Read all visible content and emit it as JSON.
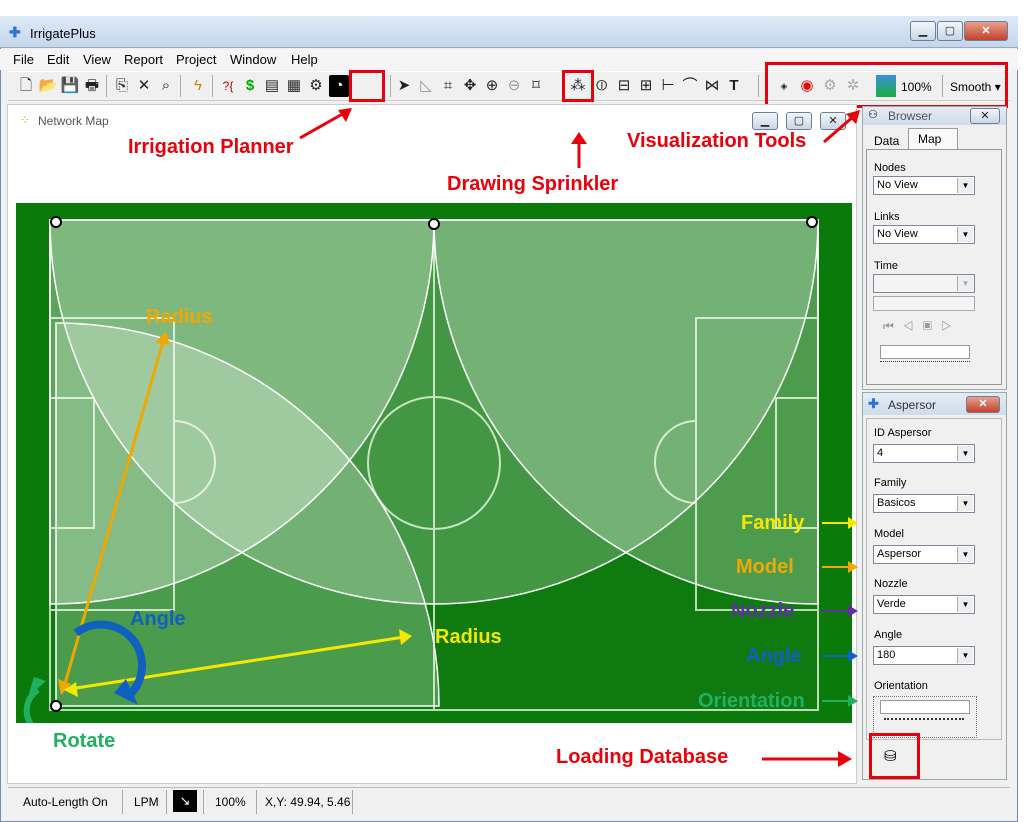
{
  "window": {
    "title": "IrrigatePlus"
  },
  "menu": [
    "File",
    "Edit",
    "View",
    "Report",
    "Project",
    "Window",
    "Help"
  ],
  "toolbar": {
    "zoom": "100%",
    "smooth": "Smooth ▾"
  },
  "network_map": {
    "title": "Network Map"
  },
  "browser": {
    "title": "Browser",
    "tabs": [
      "Data",
      "Map"
    ],
    "nodes_label": "Nodes",
    "nodes_value": "No View",
    "links_label": "Links",
    "links_value": "No View",
    "time_label": "Time"
  },
  "aspersor": {
    "title": "Aspersor",
    "id_label": "ID Aspersor",
    "id_value": "4",
    "family_label": "Family",
    "family_value": "Basicos",
    "model_label": "Model",
    "model_value": "Aspersor",
    "nozzle_label": "Nozzle",
    "nozzle_value": "Verde",
    "angle_label": "Angle",
    "angle_value": "180",
    "orientation_label": "Orientation"
  },
  "annotations": {
    "irrigation_planner": "Irrigation Planner",
    "visualization_tools": "Visualization Tools",
    "drawing_sprinkler": "Drawing Sprinkler",
    "radius_1": "Radius",
    "radius_2": "Radius",
    "angle_map": "Angle",
    "rotate": "Rotate",
    "family": "Family",
    "model": "Model",
    "nozzle": "Nozzle",
    "angle": "Angle",
    "orientation": "Orientation",
    "loading_database": "Loading Database"
  },
  "status": {
    "auto_length": "Auto-Length On",
    "units": "LPM",
    "zoom": "100%",
    "coords": "X,Y: 49.94, 5.46"
  },
  "colors": {
    "accent_red": "#e8000b",
    "field_green": "#0a7a0a",
    "annotation_orange": "#f0a800",
    "annotation_yellow": "#f5e800",
    "annotation_blue": "#1060c0",
    "annotation_purple": "#6030a0",
    "annotation_green": "#20b060"
  }
}
